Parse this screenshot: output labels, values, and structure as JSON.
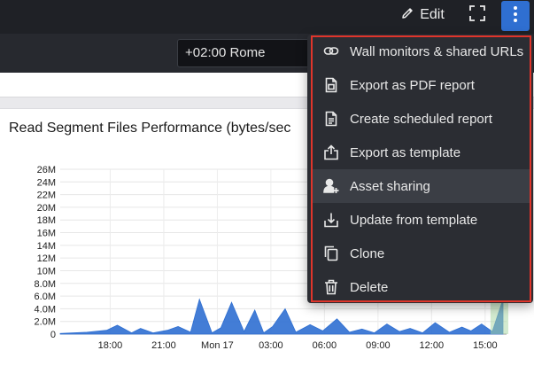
{
  "header": {
    "edit_label": "Edit",
    "icons": [
      "pencil-icon",
      "fullscreen-icon",
      "kebab-icon"
    ]
  },
  "toolbar": {
    "timezone_value": "+02:00 Rome"
  },
  "panel": {
    "title": "Read Segment Files Performance (bytes/sec"
  },
  "menu": {
    "items": [
      {
        "label": "Wall monitors & shared URLs",
        "icon": "link-icon"
      },
      {
        "label": "Export as PDF report",
        "icon": "pdf-report-icon"
      },
      {
        "label": "Create scheduled report",
        "icon": "scheduled-report-icon"
      },
      {
        "label": "Export as template",
        "icon": "export-icon"
      },
      {
        "label": "Asset sharing",
        "icon": "user-share-icon"
      },
      {
        "label": "Update from template",
        "icon": "download-icon"
      },
      {
        "label": "Clone",
        "icon": "clone-icon"
      },
      {
        "label": "Delete",
        "icon": "trash-icon"
      }
    ],
    "highlighted_item": "Asset sharing",
    "outline_color": "#e0352b"
  },
  "colors": {
    "accent": "#2f6fd1",
    "series": "#2f6fd1",
    "series_secondary": "#a5d6a0"
  },
  "chart_data": {
    "type": "area",
    "title": "Read Segment Files Performance (bytes/sec",
    "xlabel": "",
    "ylabel": "",
    "y_ticks": [
      "0",
      "2.0M",
      "4.0M",
      "6.0M",
      "8.0M",
      "10M",
      "12M",
      "14M",
      "16M",
      "18M",
      "20M",
      "22M",
      "24M",
      "26M"
    ],
    "ylim": [
      0,
      26000000
    ],
    "x_ticks": [
      "18:00",
      "21:00",
      "Mon 17",
      "03:00",
      "06:00",
      "09:00",
      "12:00",
      "15:00"
    ],
    "grid": true,
    "series": [
      {
        "x": [
          0,
          1.5,
          2.6,
          3.2,
          4.0,
          4.5,
          5.2,
          6.0,
          6.6,
          7.3,
          7.8,
          8.5,
          9.0,
          9.6,
          10.3,
          10.9,
          11.4,
          11.9,
          12.6,
          13.2,
          14.0,
          14.7,
          15.5,
          16.2,
          16.9,
          17.6,
          18.3,
          19.0,
          19.6,
          20.3,
          21.0,
          21.8,
          22.5,
          23.0,
          23.6,
          24.2,
          24.8
        ],
        "values": [
          0.1,
          0.3,
          0.6,
          1.4,
          0.2,
          0.9,
          0.2,
          0.6,
          1.2,
          0.3,
          5.5,
          0.2,
          1.0,
          5.0,
          0.4,
          3.8,
          0.2,
          1.2,
          4.0,
          0.3,
          1.5,
          0.5,
          2.4,
          0.3,
          0.8,
          0.2,
          1.6,
          0.4,
          0.9,
          0.2,
          1.8,
          0.3,
          1.1,
          0.5,
          1.6,
          0.4,
          5.5
        ]
      }
    ]
  }
}
